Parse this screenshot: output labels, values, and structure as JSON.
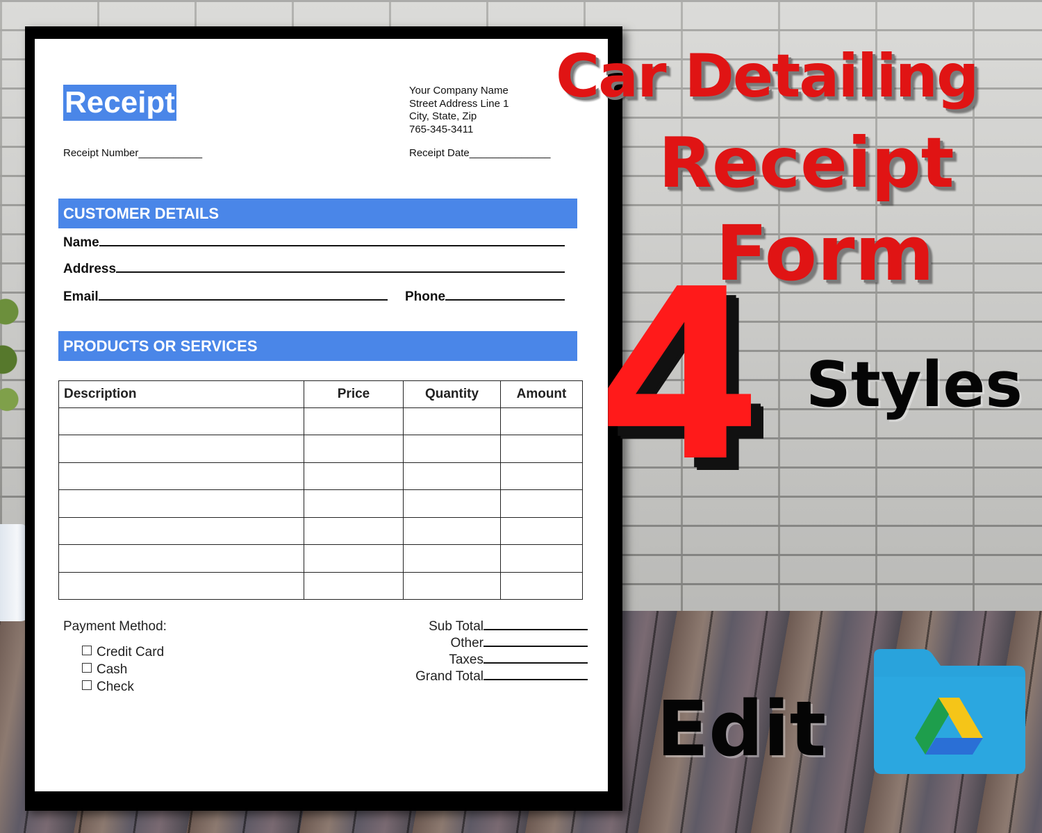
{
  "document": {
    "title": "Receipt",
    "company_lines": [
      "Your Company Name",
      "Street Address Line 1",
      "City, State, Zip",
      "765-345-3411"
    ],
    "receipt_number_label": "Receipt Number___________",
    "receipt_date_label": "Receipt Date______________",
    "customer_section": "CUSTOMER DETAILS",
    "name_label": "Name",
    "address_label": "Address",
    "email_label": "Email",
    "phone_label": "Phone",
    "products_section": "PRODUCTS OR SERVICES",
    "table_headers": [
      "Description",
      "Price",
      "Quantity",
      "Amount"
    ],
    "empty_rows": 7,
    "payment_method_label": "Payment Method:",
    "payment_options": [
      "Credit Card",
      "Cash",
      "Check"
    ],
    "totals": [
      "Sub Total",
      "Other",
      "Taxes",
      "Grand Total"
    ]
  },
  "promo": {
    "line1": "Car Detailing",
    "line2": "Receipt",
    "line3": "Form",
    "number": "4",
    "styles": "Styles",
    "edit": "Edit",
    "icon": "google-drive-folder-icon"
  },
  "colors": {
    "accent_blue": "#4a86e8",
    "promo_red": "#e01414",
    "folder_blue": "#29a3dc"
  }
}
